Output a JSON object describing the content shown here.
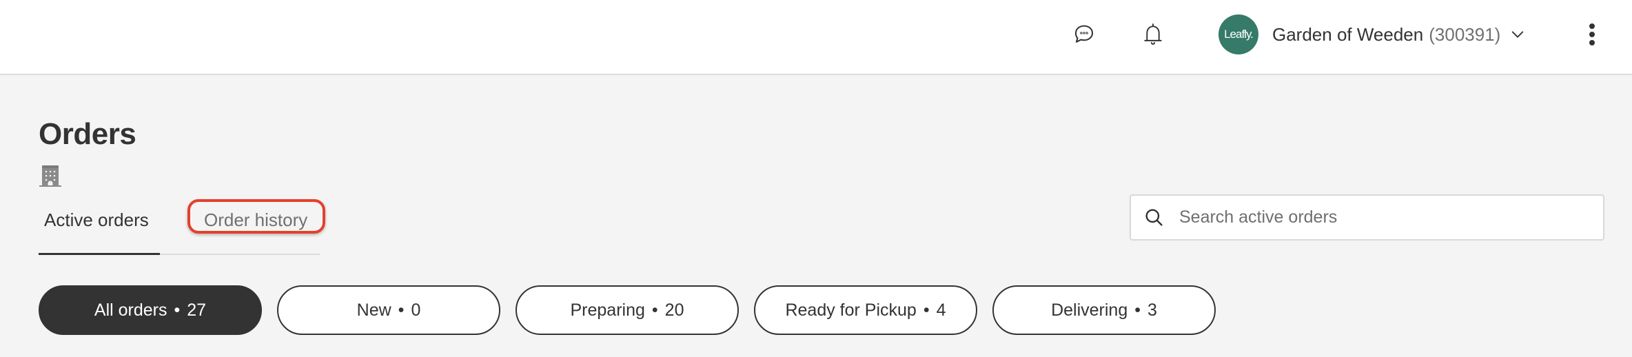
{
  "header": {
    "chat_icon": "chat-bubble-ellipsis-icon",
    "notifications_icon": "bell-icon",
    "avatar_text": "Leafly.",
    "avatar_color": "#367a69",
    "store_name": "Garden of Weeden",
    "store_id": "(300391)",
    "store_menu_icon": "chevron-down-icon",
    "more_icon": "kebab-vertical-icon"
  },
  "page": {
    "title": "Orders",
    "location_icon": "building-icon"
  },
  "tabs": [
    {
      "label": "Active orders",
      "selected": true
    },
    {
      "label": "Order history",
      "selected": false,
      "highlighted": true
    }
  ],
  "search": {
    "placeholder": "Search active orders",
    "value": "",
    "icon": "search-icon"
  },
  "filters": [
    {
      "label": "All orders",
      "count": "27",
      "selected": true
    },
    {
      "label": "New",
      "count": "0",
      "selected": false
    },
    {
      "label": "Preparing",
      "count": "20",
      "selected": false
    },
    {
      "label": "Ready for Pickup",
      "count": "4",
      "selected": false
    },
    {
      "label": "Delivering",
      "count": "3",
      "selected": false
    }
  ],
  "separator": "•",
  "colors": {
    "highlight": "#e3412c",
    "selected_pill": "#333333",
    "background": "#f4f4f4"
  }
}
